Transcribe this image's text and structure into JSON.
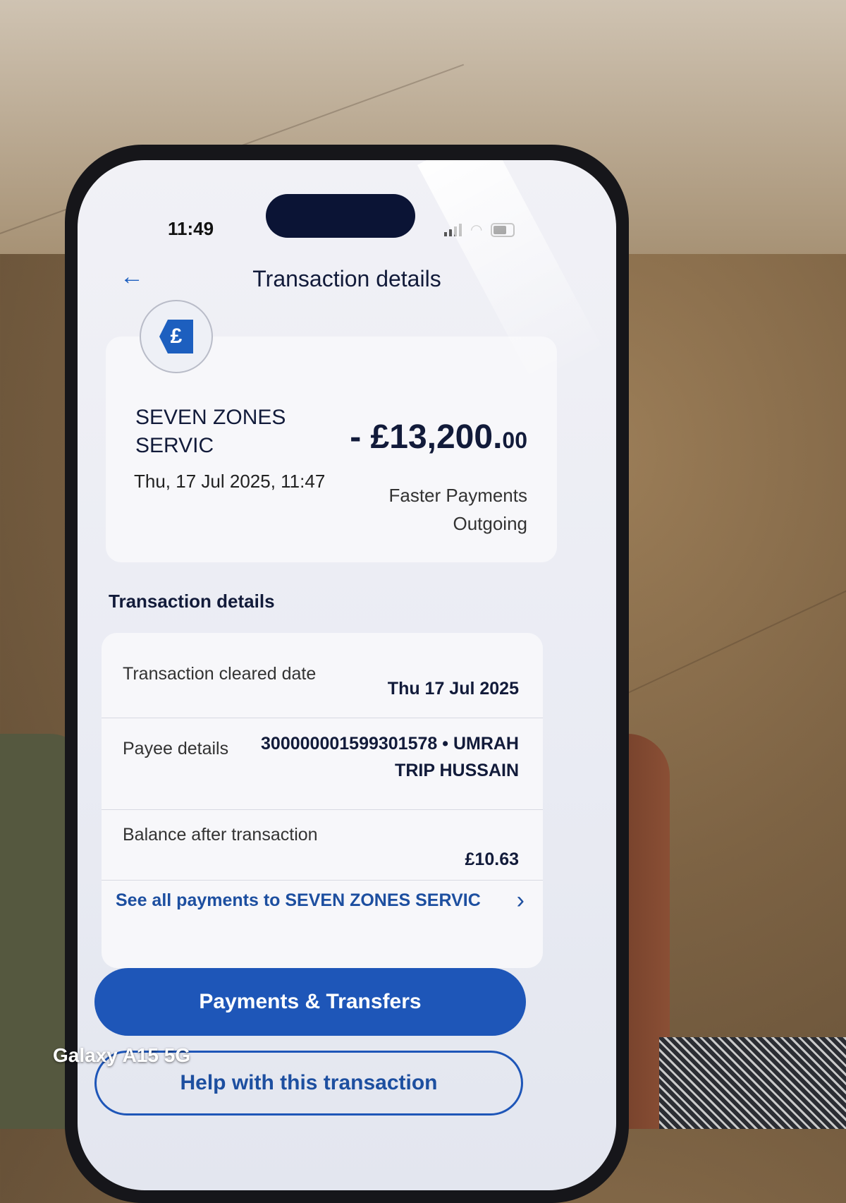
{
  "status_bar": {
    "time": "11:49"
  },
  "header": {
    "title": "Transaction details",
    "back_icon": "arrow-left-icon"
  },
  "summary": {
    "payee_icon": "pound-transfer-icon",
    "payee_name": "SEVEN ZONES SERVIC",
    "date_time": "Thu, 17 Jul 2025, 11:47",
    "amount_main": "- £13,200.",
    "amount_pence": "00",
    "payment_type": "Faster Payments Outgoing"
  },
  "details": {
    "heading": "Transaction details",
    "rows": [
      {
        "label": "Transaction cleared date",
        "value": "Thu 17 Jul 2025"
      },
      {
        "label": "Payee details",
        "value": "300000001599301578 • UMRAH TRIP HUSSAIN"
      },
      {
        "label": "Balance after transaction",
        "value": "£10.63"
      }
    ],
    "see_all_link": "See all payments to SEVEN ZONES SERVIC"
  },
  "actions": {
    "primary": "Payments & Transfers",
    "secondary": "Help with this transaction"
  },
  "watermark": "Galaxy A15 5G",
  "colors": {
    "accent": "#1e56b8",
    "text": "#121b3a"
  }
}
